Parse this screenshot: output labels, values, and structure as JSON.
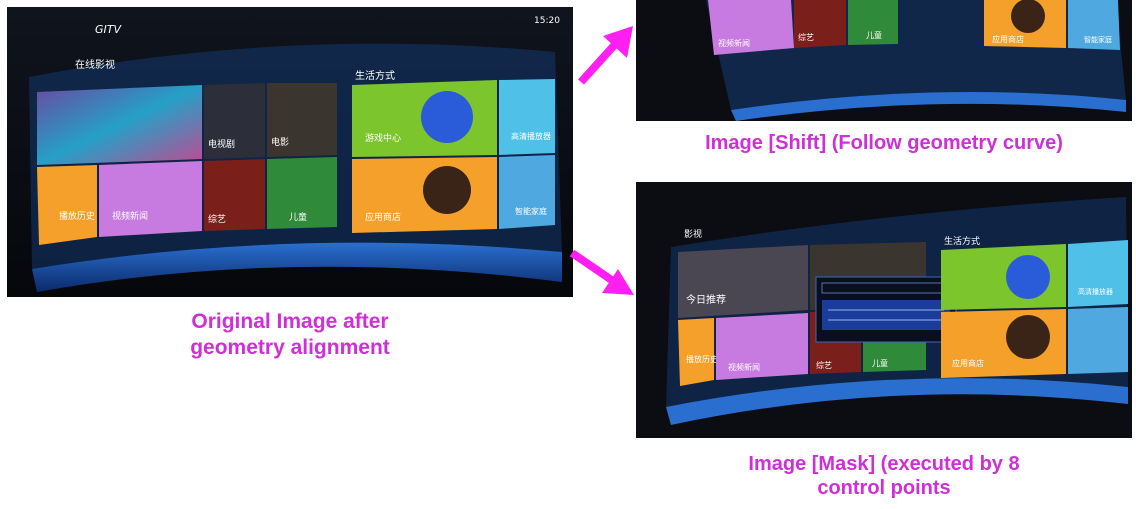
{
  "original_panel": {
    "logo": "GITV",
    "clock": "15:20",
    "section_movies": "在线影视",
    "section_lifestyle": "生活方式",
    "tiles": {
      "tv_series": "电视剧",
      "movies": "电影",
      "variety": "综艺",
      "kids": "儿童",
      "games": "游戏中心",
      "player": "高清播放器",
      "apps": "应用商店",
      "history": "播放历史",
      "video_news": "视频新闻",
      "manager": "智能家庭"
    },
    "caption_lines": [
      "Original Image after",
      "geometry alignment"
    ]
  },
  "shift_panel": {
    "tiles": {
      "video_news": "视频新闻",
      "variety": "综艺",
      "kids": "儿童",
      "apps": "应用商店",
      "manager": "智能家庭"
    },
    "caption": "Image [Shift] (Follow geometry curve)"
  },
  "mask_panel": {
    "section_movies": "影视",
    "section_lifestyle": "生活方式",
    "promo": "今日推荐",
    "tiles": {
      "history": "播放历史",
      "video_news": "视频新闻",
      "variety": "综艺",
      "kids": "儿童",
      "apps": "应用商店",
      "player": "高清播放器"
    },
    "caption_lines": [
      "Image [Mask] (executed by 8",
      "control points"
    ]
  },
  "colors": {
    "caption": "#cf2fd6",
    "arrow": "#ff1ff0",
    "green_tile": "#7cc52d",
    "orange_tile": "#f5a02a",
    "purple_tile": "#c77ae0",
    "cyan_tile": "#4fc0e8",
    "blue_curve": "#1d4fa8"
  }
}
